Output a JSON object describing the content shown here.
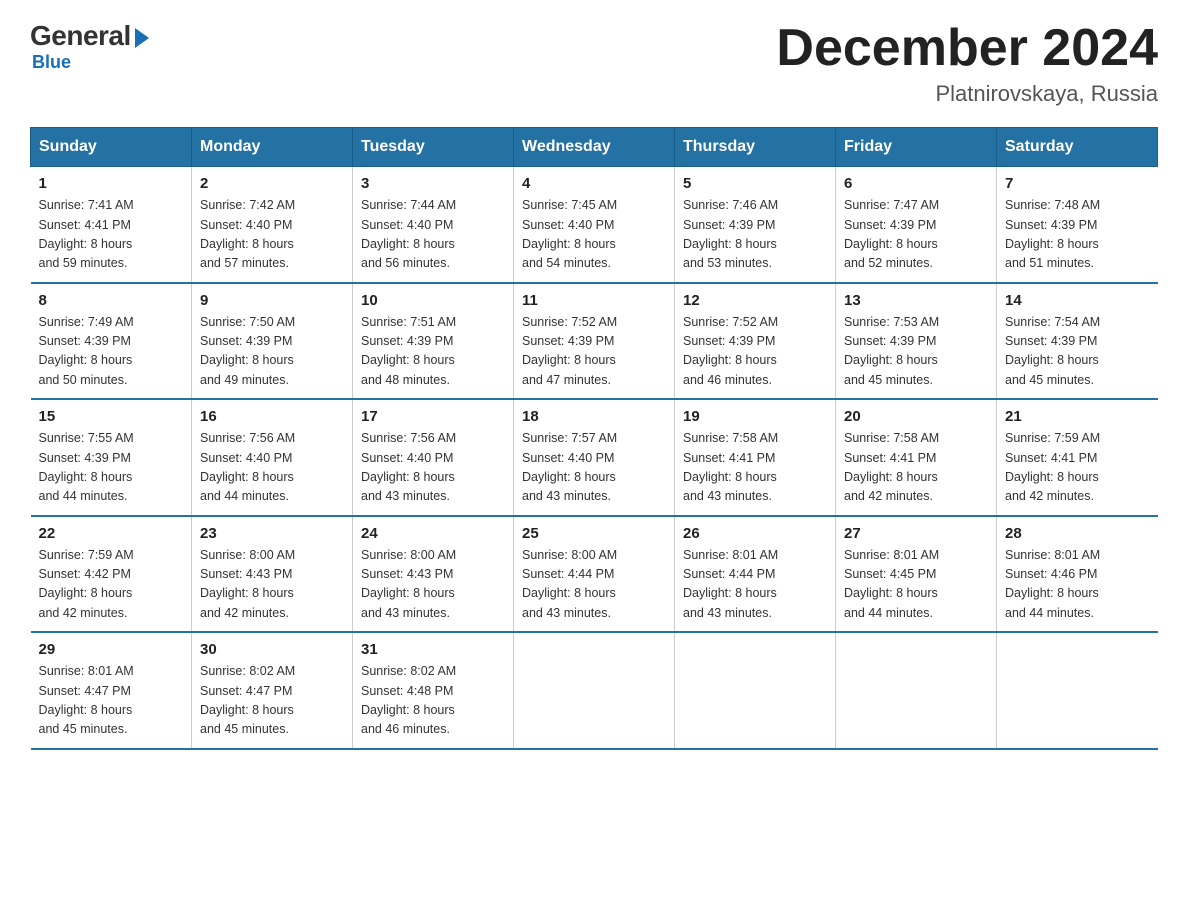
{
  "logo": {
    "general": "General",
    "blue": "Blue",
    "bottom": "Blue"
  },
  "title": "December 2024",
  "location": "Platnirovskaya, Russia",
  "headers": [
    "Sunday",
    "Monday",
    "Tuesday",
    "Wednesday",
    "Thursday",
    "Friday",
    "Saturday"
  ],
  "weeks": [
    [
      {
        "day": "1",
        "info": "Sunrise: 7:41 AM\nSunset: 4:41 PM\nDaylight: 8 hours\nand 59 minutes."
      },
      {
        "day": "2",
        "info": "Sunrise: 7:42 AM\nSunset: 4:40 PM\nDaylight: 8 hours\nand 57 minutes."
      },
      {
        "day": "3",
        "info": "Sunrise: 7:44 AM\nSunset: 4:40 PM\nDaylight: 8 hours\nand 56 minutes."
      },
      {
        "day": "4",
        "info": "Sunrise: 7:45 AM\nSunset: 4:40 PM\nDaylight: 8 hours\nand 54 minutes."
      },
      {
        "day": "5",
        "info": "Sunrise: 7:46 AM\nSunset: 4:39 PM\nDaylight: 8 hours\nand 53 minutes."
      },
      {
        "day": "6",
        "info": "Sunrise: 7:47 AM\nSunset: 4:39 PM\nDaylight: 8 hours\nand 52 minutes."
      },
      {
        "day": "7",
        "info": "Sunrise: 7:48 AM\nSunset: 4:39 PM\nDaylight: 8 hours\nand 51 minutes."
      }
    ],
    [
      {
        "day": "8",
        "info": "Sunrise: 7:49 AM\nSunset: 4:39 PM\nDaylight: 8 hours\nand 50 minutes."
      },
      {
        "day": "9",
        "info": "Sunrise: 7:50 AM\nSunset: 4:39 PM\nDaylight: 8 hours\nand 49 minutes."
      },
      {
        "day": "10",
        "info": "Sunrise: 7:51 AM\nSunset: 4:39 PM\nDaylight: 8 hours\nand 48 minutes."
      },
      {
        "day": "11",
        "info": "Sunrise: 7:52 AM\nSunset: 4:39 PM\nDaylight: 8 hours\nand 47 minutes."
      },
      {
        "day": "12",
        "info": "Sunrise: 7:52 AM\nSunset: 4:39 PM\nDaylight: 8 hours\nand 46 minutes."
      },
      {
        "day": "13",
        "info": "Sunrise: 7:53 AM\nSunset: 4:39 PM\nDaylight: 8 hours\nand 45 minutes."
      },
      {
        "day": "14",
        "info": "Sunrise: 7:54 AM\nSunset: 4:39 PM\nDaylight: 8 hours\nand 45 minutes."
      }
    ],
    [
      {
        "day": "15",
        "info": "Sunrise: 7:55 AM\nSunset: 4:39 PM\nDaylight: 8 hours\nand 44 minutes."
      },
      {
        "day": "16",
        "info": "Sunrise: 7:56 AM\nSunset: 4:40 PM\nDaylight: 8 hours\nand 44 minutes."
      },
      {
        "day": "17",
        "info": "Sunrise: 7:56 AM\nSunset: 4:40 PM\nDaylight: 8 hours\nand 43 minutes."
      },
      {
        "day": "18",
        "info": "Sunrise: 7:57 AM\nSunset: 4:40 PM\nDaylight: 8 hours\nand 43 minutes."
      },
      {
        "day": "19",
        "info": "Sunrise: 7:58 AM\nSunset: 4:41 PM\nDaylight: 8 hours\nand 43 minutes."
      },
      {
        "day": "20",
        "info": "Sunrise: 7:58 AM\nSunset: 4:41 PM\nDaylight: 8 hours\nand 42 minutes."
      },
      {
        "day": "21",
        "info": "Sunrise: 7:59 AM\nSunset: 4:41 PM\nDaylight: 8 hours\nand 42 minutes."
      }
    ],
    [
      {
        "day": "22",
        "info": "Sunrise: 7:59 AM\nSunset: 4:42 PM\nDaylight: 8 hours\nand 42 minutes."
      },
      {
        "day": "23",
        "info": "Sunrise: 8:00 AM\nSunset: 4:43 PM\nDaylight: 8 hours\nand 42 minutes."
      },
      {
        "day": "24",
        "info": "Sunrise: 8:00 AM\nSunset: 4:43 PM\nDaylight: 8 hours\nand 43 minutes."
      },
      {
        "day": "25",
        "info": "Sunrise: 8:00 AM\nSunset: 4:44 PM\nDaylight: 8 hours\nand 43 minutes."
      },
      {
        "day": "26",
        "info": "Sunrise: 8:01 AM\nSunset: 4:44 PM\nDaylight: 8 hours\nand 43 minutes."
      },
      {
        "day": "27",
        "info": "Sunrise: 8:01 AM\nSunset: 4:45 PM\nDaylight: 8 hours\nand 44 minutes."
      },
      {
        "day": "28",
        "info": "Sunrise: 8:01 AM\nSunset: 4:46 PM\nDaylight: 8 hours\nand 44 minutes."
      }
    ],
    [
      {
        "day": "29",
        "info": "Sunrise: 8:01 AM\nSunset: 4:47 PM\nDaylight: 8 hours\nand 45 minutes."
      },
      {
        "day": "30",
        "info": "Sunrise: 8:02 AM\nSunset: 4:47 PM\nDaylight: 8 hours\nand 45 minutes."
      },
      {
        "day": "31",
        "info": "Sunrise: 8:02 AM\nSunset: 4:48 PM\nDaylight: 8 hours\nand 46 minutes."
      },
      null,
      null,
      null,
      null
    ]
  ]
}
